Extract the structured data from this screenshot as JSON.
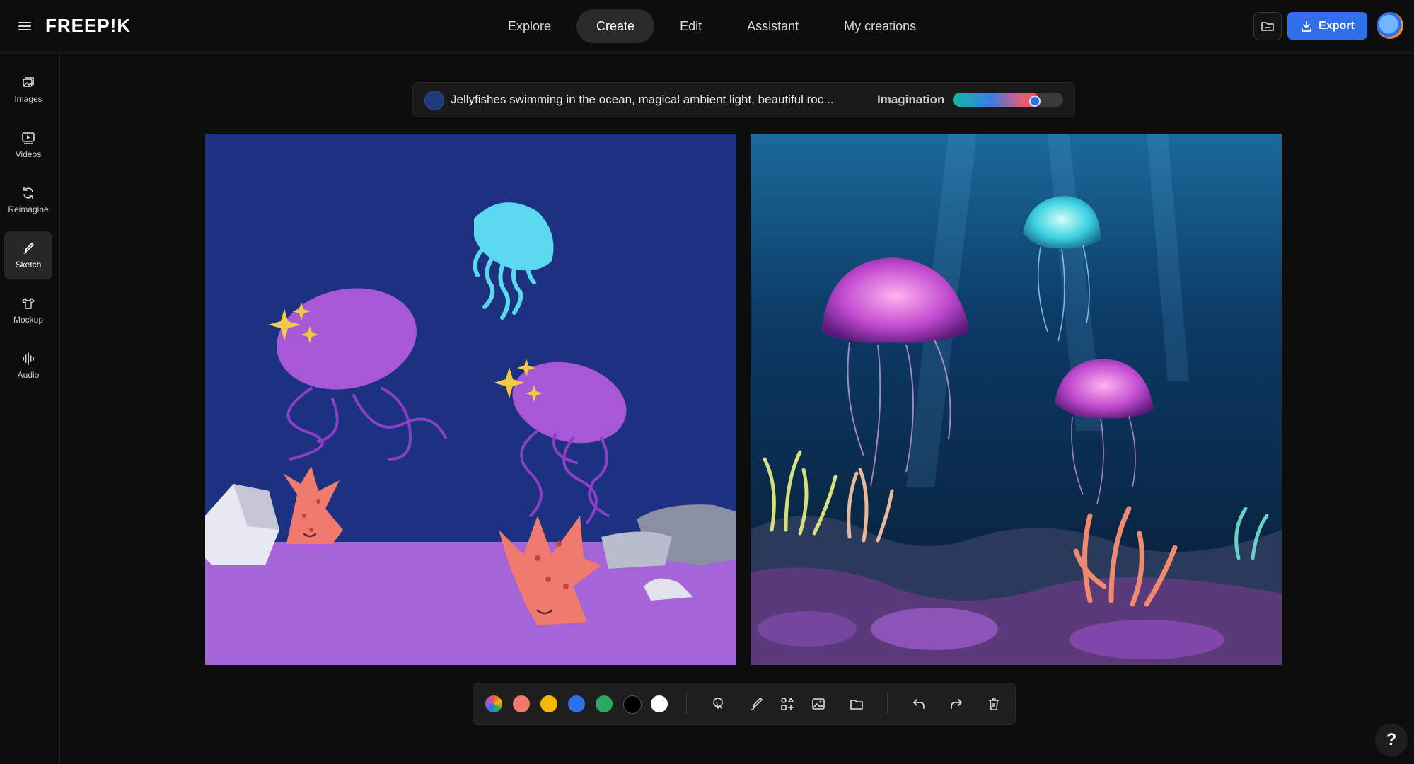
{
  "header": {
    "logo": "FREEP!K",
    "nav": [
      {
        "label": "Explore"
      },
      {
        "label": "Create",
        "active": true
      },
      {
        "label": "Edit"
      },
      {
        "label": "Assistant"
      },
      {
        "label": "My creations"
      }
    ],
    "export_label": "Export"
  },
  "sidebar": {
    "items": [
      {
        "label": "Images",
        "icon": "images-icon"
      },
      {
        "label": "Videos",
        "icon": "videos-icon"
      },
      {
        "label": "Reimagine",
        "icon": "reimagine-icon"
      },
      {
        "label": "Sketch",
        "icon": "sketch-icon",
        "active": true
      },
      {
        "label": "Mockup",
        "icon": "mockup-icon"
      },
      {
        "label": "Audio",
        "icon": "audio-icon"
      }
    ]
  },
  "prompt": {
    "text": "Jellyfishes swimming in the ocean, magical ambient light, beautiful roc...",
    "imagination_label": "Imagination",
    "imagination_level": 0.78
  },
  "toolbar": {
    "colors": [
      "#f0a040",
      "#f07a6e",
      "#f5b800",
      "#2f6fea",
      "#2aa864",
      "#000000",
      "#ffffff"
    ],
    "tools": [
      "pointer-icon",
      "brush-icon",
      "shapes-icon",
      "image-icon",
      "folder-icon",
      "undo-icon",
      "redo-icon",
      "trash-icon"
    ]
  },
  "help_label": "?",
  "colors": {
    "accent": "#2f6fea",
    "background": "#0d0d0d"
  }
}
